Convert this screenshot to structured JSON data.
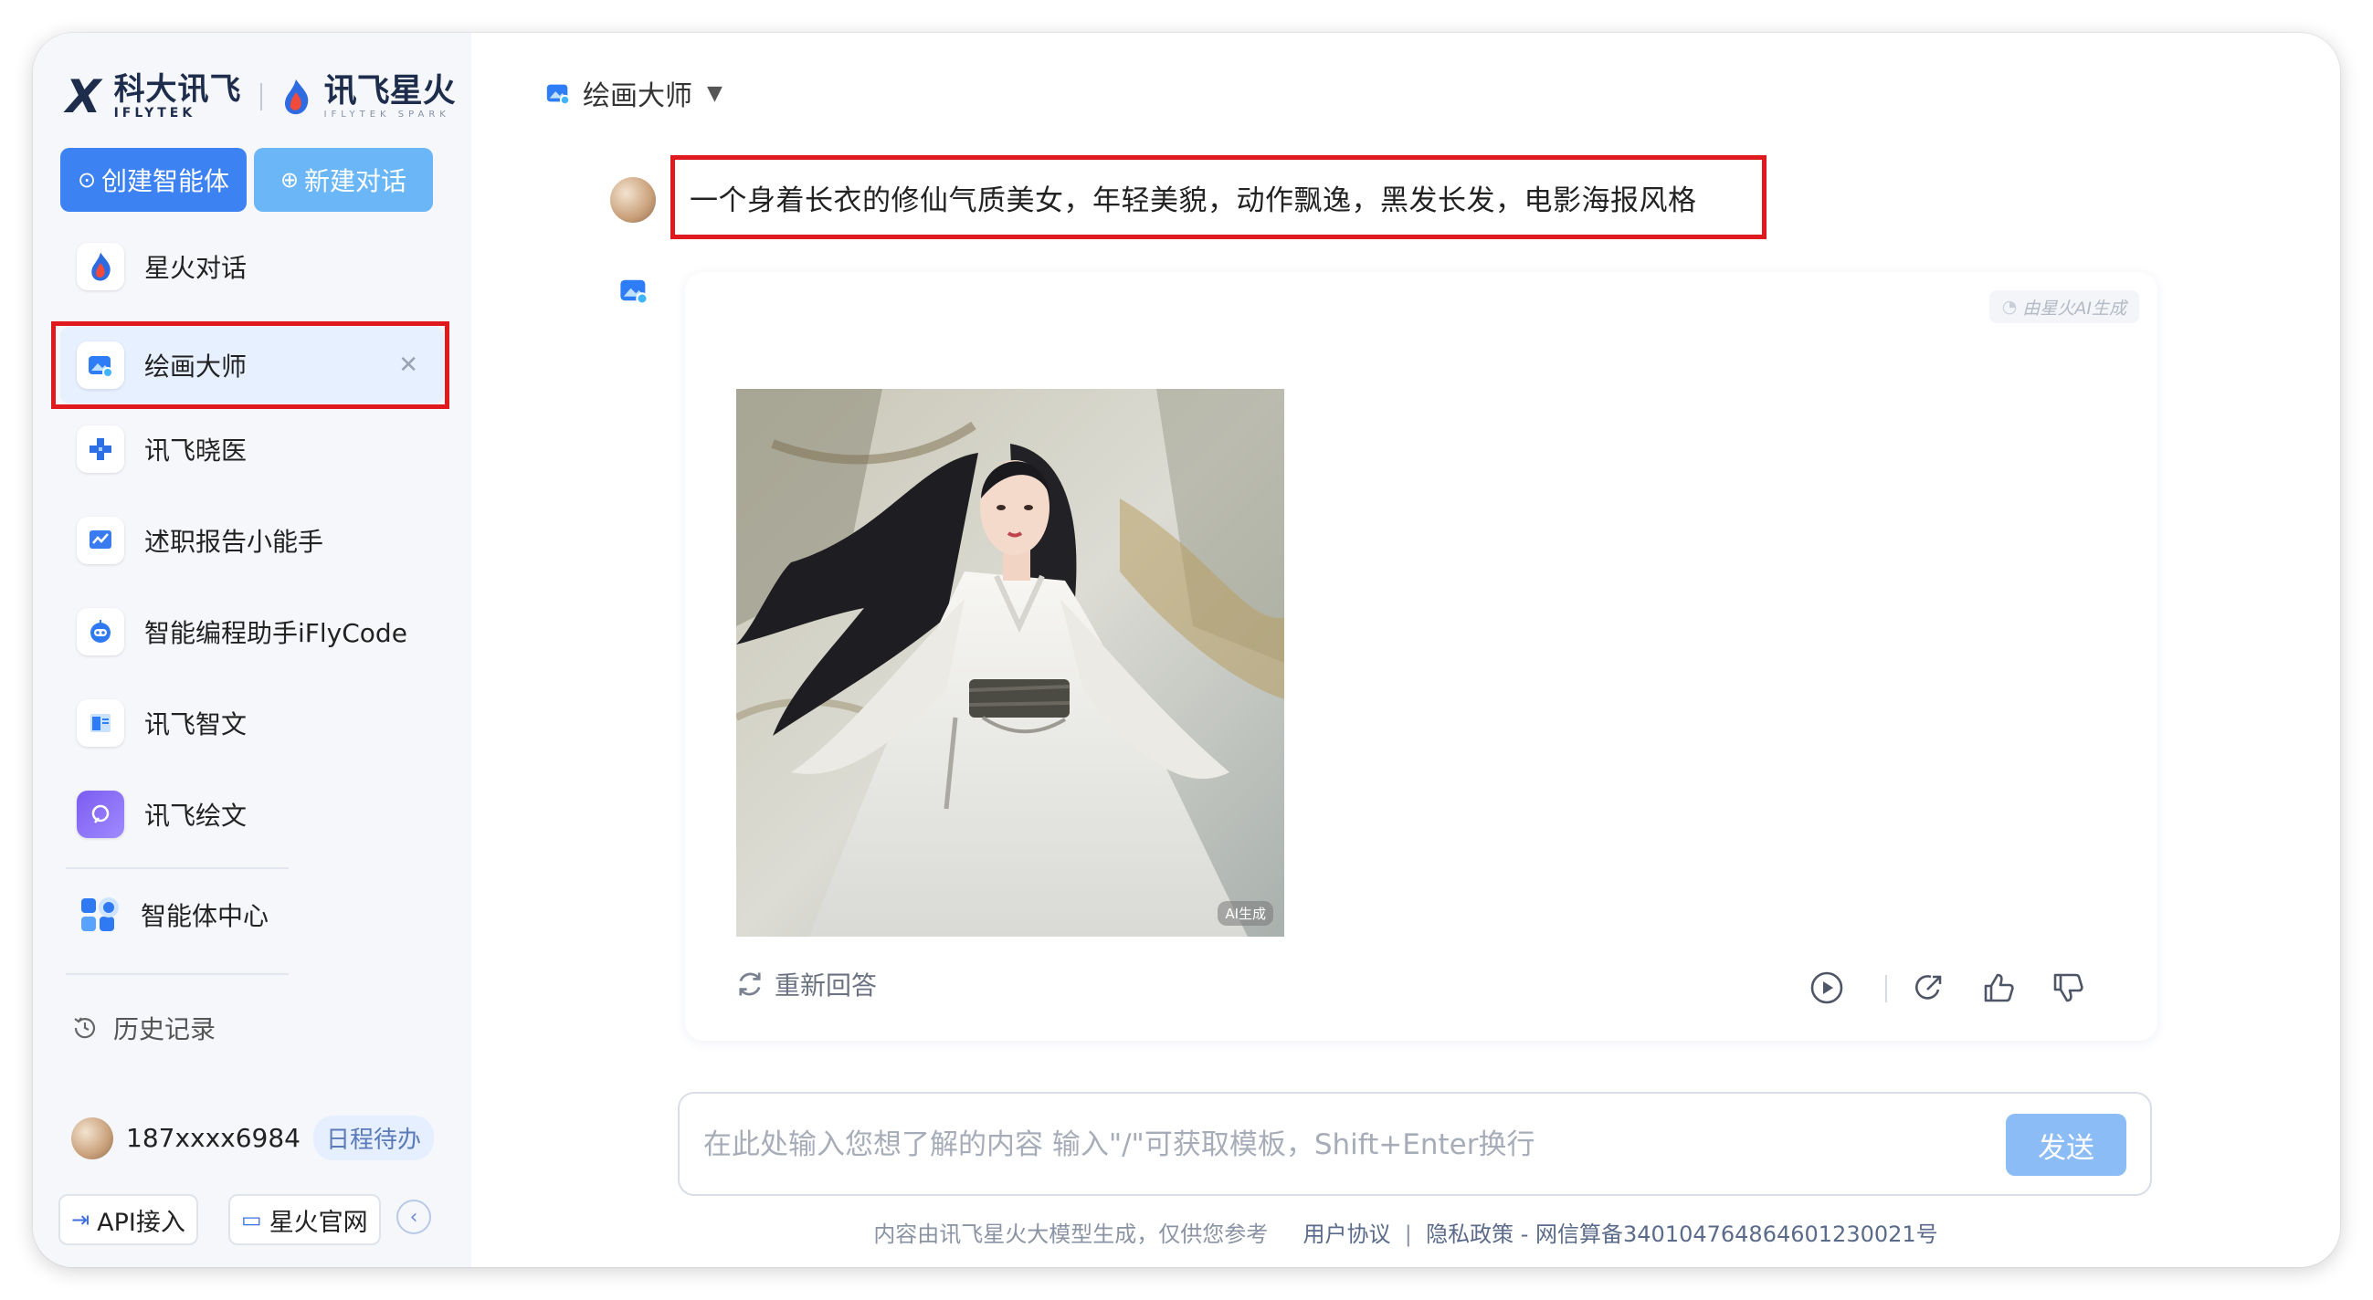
{
  "sidebar": {
    "logo": {
      "brand1": "科大讯飞",
      "brand1_en": "IFLYTEK",
      "brand2": "讯飞星火",
      "brand2_en": "IFLYTEK SPARK"
    },
    "create_agent_label": "创建智能体",
    "new_chat_label": "新建对话",
    "items": [
      {
        "label": "星火对话",
        "icon": "spark-flame-icon"
      },
      {
        "label": "绘画大师",
        "icon": "paint-master-icon",
        "active": true
      },
      {
        "label": "讯飞晓医",
        "icon": "medical-cross-icon"
      },
      {
        "label": "述职报告小能手",
        "icon": "report-chart-icon"
      },
      {
        "label": "智能编程助手iFlyCode",
        "icon": "robot-icon"
      },
      {
        "label": "讯飞智文",
        "icon": "doc-icon"
      },
      {
        "label": "讯飞绘文",
        "icon": "draw-circle-icon"
      }
    ],
    "agent_center_label": "智能体中心",
    "history_label": "历史记录",
    "user": {
      "name": "187xxxx6984",
      "badge": "日程待办"
    },
    "api_label": "API接入",
    "site_label": "星火官网"
  },
  "main": {
    "title": "绘画大师",
    "question": "一个身着长衣的修仙气质美女，年轻美貌，动作飘逸，黑发长发，电影海报风格",
    "ai_tag": "由星火AI生成",
    "image_mark": "AI生成",
    "regen_label": "重新回答"
  },
  "input": {
    "placeholder": "在此处输入您想了解的内容 输入\"/\"可获取模板，Shift+Enter换行",
    "send_label": "发送"
  },
  "footer": {
    "disclaimer": "内容由讯飞星火大模型生成，仅供您参考",
    "agreement": "用户协议",
    "privacy": "隐私政策",
    "filing": "- 网信算备340104764864601230021号"
  },
  "colors": {
    "accent": "#3d82f2",
    "accent_light": "#6ab6f6",
    "highlight": "#e0191f",
    "send": "#8bbcf6"
  }
}
